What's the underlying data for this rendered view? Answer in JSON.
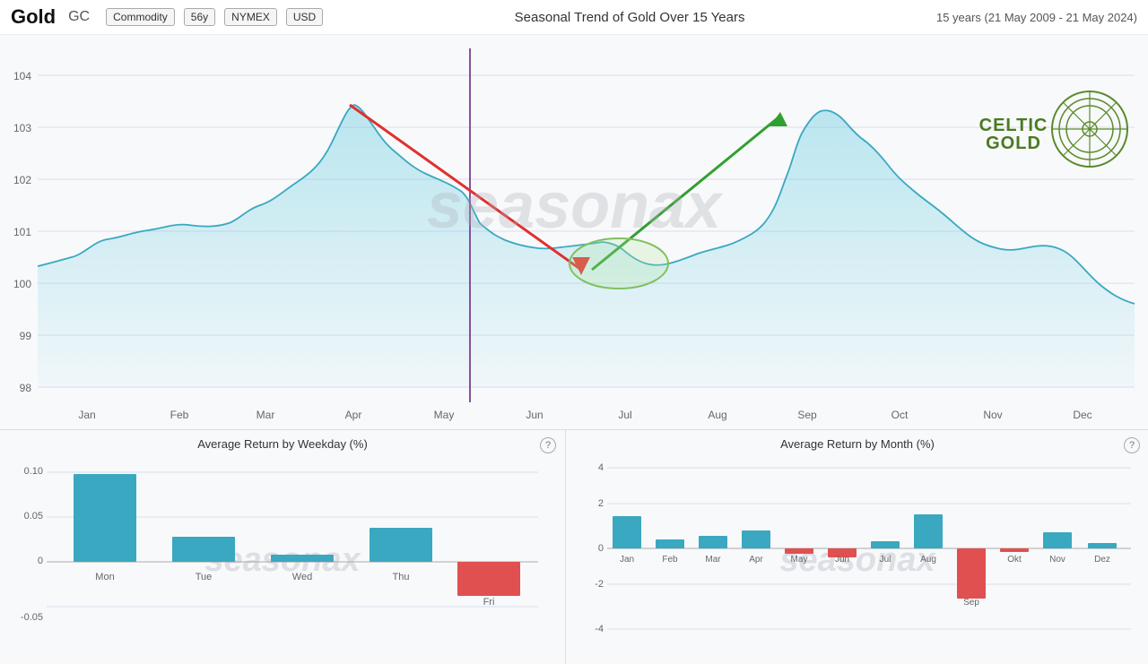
{
  "header": {
    "title": "Gold",
    "ticker": "GC",
    "tags": [
      "Commodity",
      "56y",
      "NYMEX",
      "USD"
    ],
    "chart_title": "Seasonal Trend of Gold Over 15 Years",
    "date_range": "15 years (21 May 2009 - 21 May 2024)"
  },
  "main_chart": {
    "watermark": "seasonax",
    "y_labels": [
      "104",
      "103",
      "102",
      "101",
      "100",
      "99",
      "98"
    ],
    "x_labels": [
      "Jan",
      "Feb",
      "Mar",
      "Apr",
      "May",
      "Jun",
      "Jul",
      "Aug",
      "Sep",
      "Oct",
      "Nov",
      "Dec"
    ]
  },
  "weekday_panel": {
    "title": "Average Return by Weekday (%)",
    "watermark": "seasonax",
    "help": "?",
    "y_labels": [
      "0.10",
      "0.05",
      "0",
      "-0.05"
    ],
    "bars": [
      {
        "label": "Mon",
        "value": 0.098,
        "color": "#3fa8c0"
      },
      {
        "label": "Tue",
        "value": 0.028,
        "color": "#3fa8c0"
      },
      {
        "label": "Wed",
        "value": 0.008,
        "color": "#3fa8c0"
      },
      {
        "label": "Thu",
        "value": 0.038,
        "color": "#3fa8c0"
      },
      {
        "label": "Fri",
        "value": -0.038,
        "color": "#e05050"
      }
    ]
  },
  "month_panel": {
    "title": "Average Return by Month (%)",
    "watermark": "seasonax",
    "help": "?",
    "y_labels": [
      "4",
      "2",
      "0",
      "-2",
      "-4"
    ],
    "bars": [
      {
        "label": "Jan",
        "value": 1.8,
        "color": "#3fa8c0"
      },
      {
        "label": "Feb",
        "value": 0.5,
        "color": "#3fa8c0"
      },
      {
        "label": "Mar",
        "value": 0.7,
        "color": "#3fa8c0"
      },
      {
        "label": "Apr",
        "value": 1.0,
        "color": "#3fa8c0"
      },
      {
        "label": "May",
        "value": -0.3,
        "color": "#e05050"
      },
      {
        "label": "Jun",
        "value": -0.5,
        "color": "#e05050"
      },
      {
        "label": "Jul",
        "value": 0.4,
        "color": "#3fa8c0"
      },
      {
        "label": "Aug",
        "value": 1.9,
        "color": "#3fa8c0"
      },
      {
        "label": "Sep",
        "value": -2.8,
        "color": "#e05050"
      },
      {
        "label": "Okt",
        "value": -0.2,
        "color": "#e05050"
      },
      {
        "label": "Nov",
        "value": 0.9,
        "color": "#3fa8c0"
      },
      {
        "label": "Dez",
        "value": 0.3,
        "color": "#3fa8c0"
      }
    ]
  }
}
